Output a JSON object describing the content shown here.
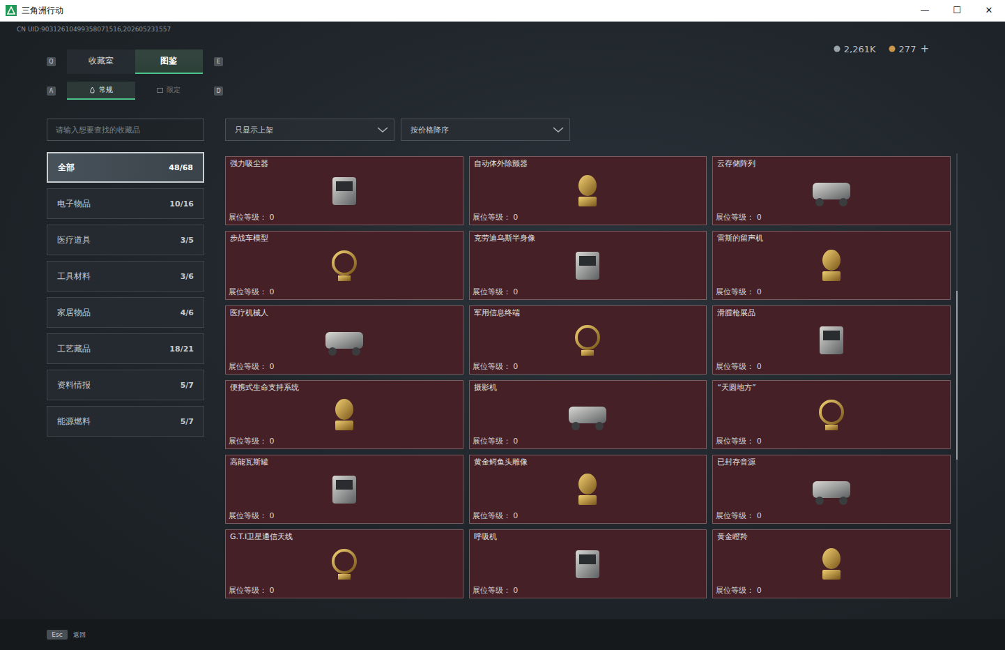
{
  "window": {
    "title": "三角洲行动",
    "controls": [
      "—",
      "☐",
      "✕"
    ]
  },
  "uid": "CN UID:90312610499358071516,202605231557",
  "currency": [
    {
      "value": "2,261K",
      "color": "#9aa3aa"
    },
    {
      "value": "277",
      "color": "#c9964a"
    }
  ],
  "currency_add": "+",
  "tabs": {
    "prev_key": "Q",
    "next_key": "E",
    "items": [
      {
        "label": "收藏室",
        "selected": false
      },
      {
        "label": "图鉴",
        "selected": true
      }
    ]
  },
  "subtabs": {
    "prev_key": "A",
    "next_key": "D",
    "items": [
      {
        "label": "常规",
        "selected": true
      },
      {
        "label": "限定",
        "selected": false
      }
    ]
  },
  "search": {
    "placeholder": "请输入想要查找的收藏品"
  },
  "filters": [
    {
      "label": "只显示上架"
    },
    {
      "label": "按价格降序"
    }
  ],
  "categories": [
    {
      "name": "全部",
      "count": "48/68",
      "selected": true
    },
    {
      "name": "电子物品",
      "count": "10/16",
      "selected": false
    },
    {
      "name": "医疗道具",
      "count": "3/5",
      "selected": false
    },
    {
      "name": "工具材料",
      "count": "3/6",
      "selected": false
    },
    {
      "name": "家居物品",
      "count": "4/6",
      "selected": false
    },
    {
      "name": "工艺藏品",
      "count": "18/21",
      "selected": false
    },
    {
      "name": "资料情报",
      "count": "5/7",
      "selected": false
    },
    {
      "name": "能源燃料",
      "count": "5/7",
      "selected": false
    }
  ],
  "items": [
    {
      "name": "强力吸尘器",
      "level_label": "展位等级：",
      "level": "0"
    },
    {
      "name": "自动体外除颤器",
      "level_label": "展位等级：",
      "level": "0"
    },
    {
      "name": "云存储阵列",
      "level_label": "展位等级：",
      "level": "0"
    },
    {
      "name": "步战车模型",
      "level_label": "展位等级：",
      "level": "0"
    },
    {
      "name": "克劳迪乌斯半身像",
      "level_label": "展位等级：",
      "level": "0"
    },
    {
      "name": "雷斯的留声机",
      "level_label": "展位等级：",
      "level": "0"
    },
    {
      "name": "医疗机械人",
      "level_label": "展位等级：",
      "level": "0"
    },
    {
      "name": "军用信息终端",
      "level_label": "展位等级：",
      "level": "0"
    },
    {
      "name": "滑膛枪展品",
      "level_label": "展位等级：",
      "level": "0"
    },
    {
      "name": "便携式生命支持系统",
      "level_label": "展位等级：",
      "level": "0"
    },
    {
      "name": "摄影机",
      "level_label": "展位等级：",
      "level": "0"
    },
    {
      "name": "“天圆地方”",
      "level_label": "展位等级：",
      "level": "0"
    },
    {
      "name": "高能瓦斯罐",
      "level_label": "展位等级：",
      "level": "0"
    },
    {
      "name": "黄金鳄鱼头雕像",
      "level_label": "展位等级：",
      "level": "0"
    },
    {
      "name": "已封存音源",
      "level_label": "展位等级：",
      "level": "0"
    },
    {
      "name": "G.T.I卫星通信天线",
      "level_label": "展位等级：",
      "level": "0"
    },
    {
      "name": "呼吸机",
      "level_label": "展位等级：",
      "level": "0"
    },
    {
      "name": "黄金瞪羚",
      "level_label": "展位等级：",
      "level": "0"
    }
  ],
  "scrollbar": {
    "position": 0.31,
    "size": 0.38
  },
  "footer": {
    "key": "Esc",
    "label": "返回"
  }
}
